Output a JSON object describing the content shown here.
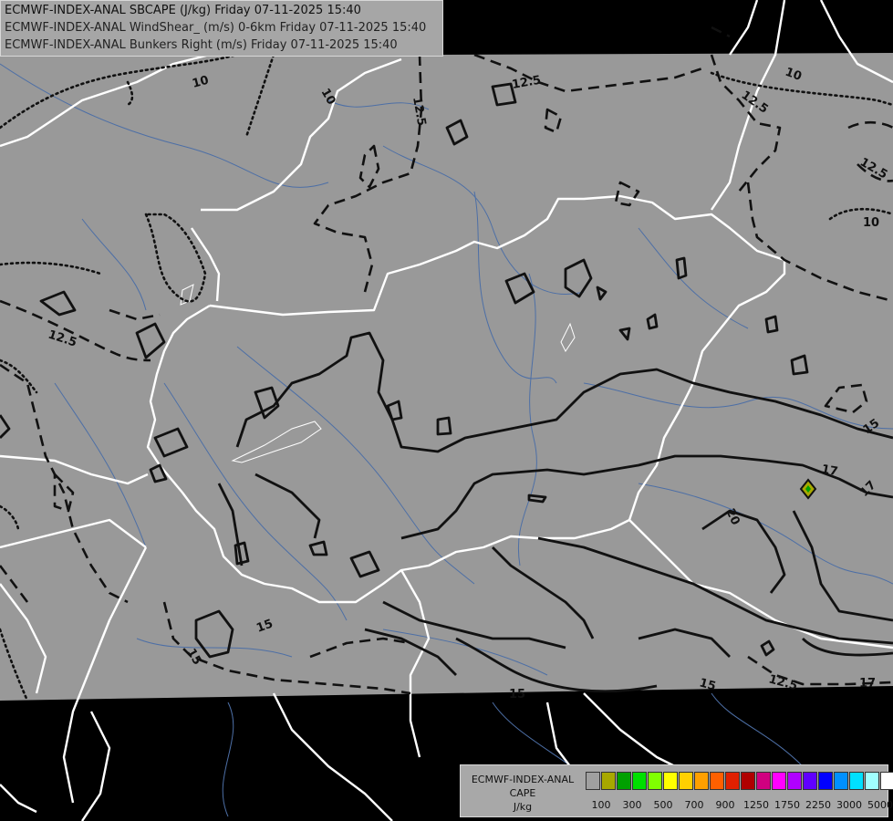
{
  "header": {
    "line1": "ECMWF-INDEX-ANAL SBCAPE (J/kg) Friday 07-11-2025 15:40",
    "line2": "ECMWF-INDEX-ANAL WindShear_ (m/s) 0-6km Friday 07-11-2025 15:40",
    "line3": "ECMWF-INDEX-ANAL Bunkers Right (m/s) Friday 07-11-2025 15:40"
  },
  "contour_labels": {
    "l10a": "10",
    "l10b": "10",
    "l10c": "10",
    "l10d": "10",
    "l125a": "12.5",
    "l125b": "12.5",
    "l125c": "12.5",
    "l125d": "12.5",
    "l125e": "12.5",
    "l125f": "12.5",
    "l15a": "15",
    "l15b": "15",
    "l15c": "15",
    "l15d": "15",
    "l17a": "17",
    "l17b": "17",
    "l17c": "17",
    "l20": "20"
  },
  "legend": {
    "line1": "ECMWF-INDEX-ANAL",
    "line2": "CAPE",
    "line3": "J/kg",
    "colors": [
      "#a0a0a0",
      "#a8a800",
      "#00a000",
      "#00e000",
      "#80ff00",
      "#ffff00",
      "#ffd000",
      "#ffa000",
      "#ff6000",
      "#e02000",
      "#b00000",
      "#d00080",
      "#ff00ff",
      "#b000ff",
      "#6000ff",
      "#0000ff",
      "#0090ff",
      "#00e0ff",
      "#a0ffff",
      "#ffffff"
    ],
    "ticks": [
      "100",
      "300",
      "500",
      "700",
      "900",
      "1250",
      "1750",
      "2250",
      "3000",
      "5000"
    ]
  }
}
